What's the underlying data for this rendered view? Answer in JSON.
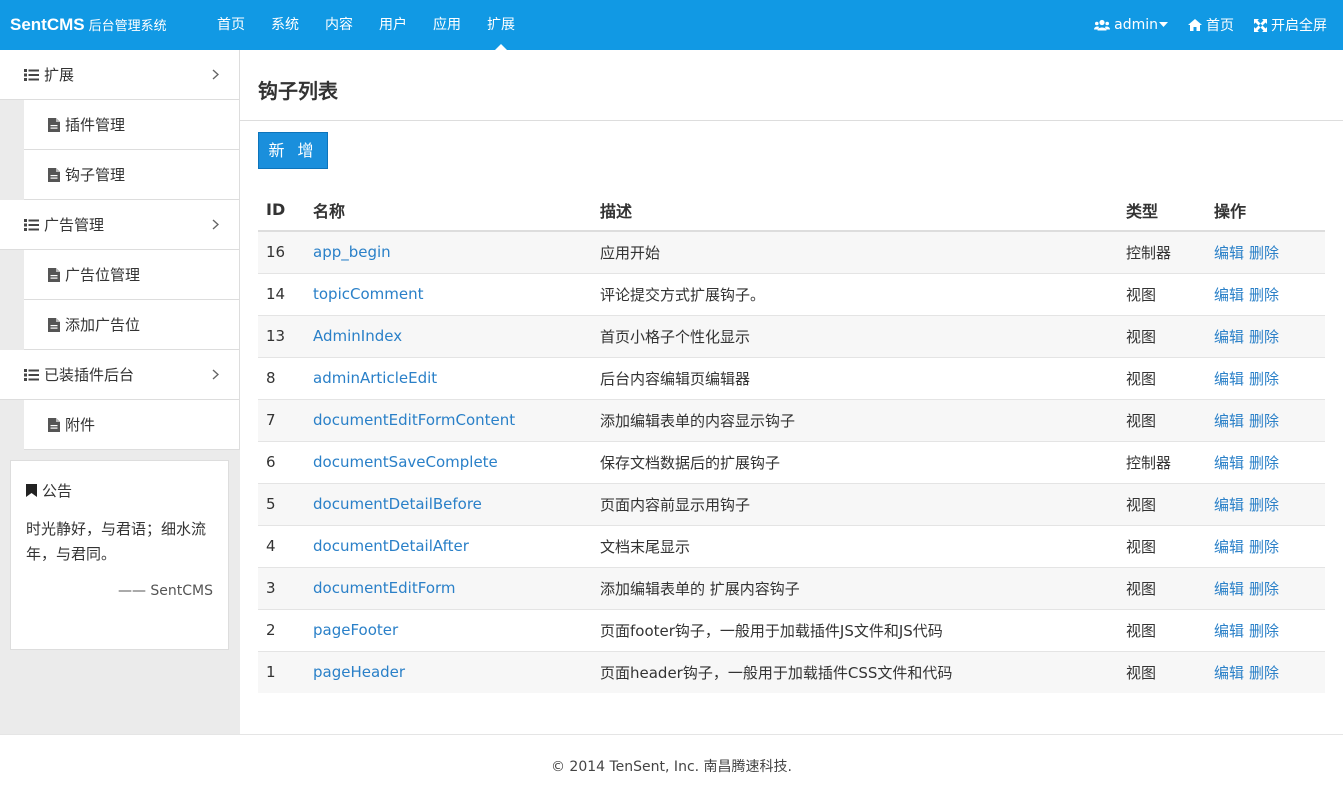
{
  "header": {
    "brand": "SentCMS",
    "brand_sub": "后台管理系统",
    "nav": [
      "首页",
      "系统",
      "内容",
      "用户",
      "应用",
      "扩展"
    ],
    "active_nav": "扩展",
    "user": "admin",
    "home": "首页",
    "fullscreen": "开启全屏"
  },
  "sidebar": {
    "groups": [
      {
        "label": "扩展",
        "items": [
          "插件管理",
          "钩子管理"
        ]
      },
      {
        "label": "广告管理",
        "items": [
          "广告位管理",
          "添加广告位"
        ]
      },
      {
        "label": "已装插件后台",
        "items": [
          "附件"
        ]
      }
    ],
    "notice": {
      "title": "公告",
      "body": "时光静好，与君语；细水流年，与君同。",
      "sign": "—— SentCMS"
    }
  },
  "main": {
    "title": "钩子列表",
    "add_button": "新 增",
    "columns": [
      "ID",
      "名称",
      "描述",
      "类型",
      "操作"
    ],
    "rows": [
      {
        "id": "16",
        "name": "app_begin",
        "desc": "应用开始",
        "type": "控制器"
      },
      {
        "id": "14",
        "name": "topicComment",
        "desc": "评论提交方式扩展钩子。",
        "type": "视图"
      },
      {
        "id": "13",
        "name": "AdminIndex",
        "desc": "首页小格子个性化显示",
        "type": "视图"
      },
      {
        "id": "8",
        "name": "adminArticleEdit",
        "desc": "后台内容编辑页编辑器",
        "type": "视图"
      },
      {
        "id": "7",
        "name": "documentEditFormContent",
        "desc": "添加编辑表单的内容显示钩子",
        "type": "视图"
      },
      {
        "id": "6",
        "name": "documentSaveComplete",
        "desc": "保存文档数据后的扩展钩子",
        "type": "控制器"
      },
      {
        "id": "5",
        "name": "documentDetailBefore",
        "desc": "页面内容前显示用钩子",
        "type": "视图"
      },
      {
        "id": "4",
        "name": "documentDetailAfter",
        "desc": "文档末尾显示",
        "type": "视图"
      },
      {
        "id": "3",
        "name": "documentEditForm",
        "desc": "添加编辑表单的 扩展内容钩子",
        "type": "视图"
      },
      {
        "id": "2",
        "name": "pageFooter",
        "desc": "页面footer钩子，一般用于加载插件JS文件和JS代码",
        "type": "视图"
      },
      {
        "id": "1",
        "name": "pageHeader",
        "desc": "页面header钩子，一般用于加载插件CSS文件和代码",
        "type": "视图"
      }
    ],
    "edit_label": "编辑",
    "delete_label": "删除"
  },
  "footer": {
    "text": "© 2014 TenSent, Inc. 南昌腾速科技."
  },
  "colors": {
    "header_bg": "#1199e4",
    "button_bg": "#1a8fdc",
    "link": "#2a80c8"
  }
}
